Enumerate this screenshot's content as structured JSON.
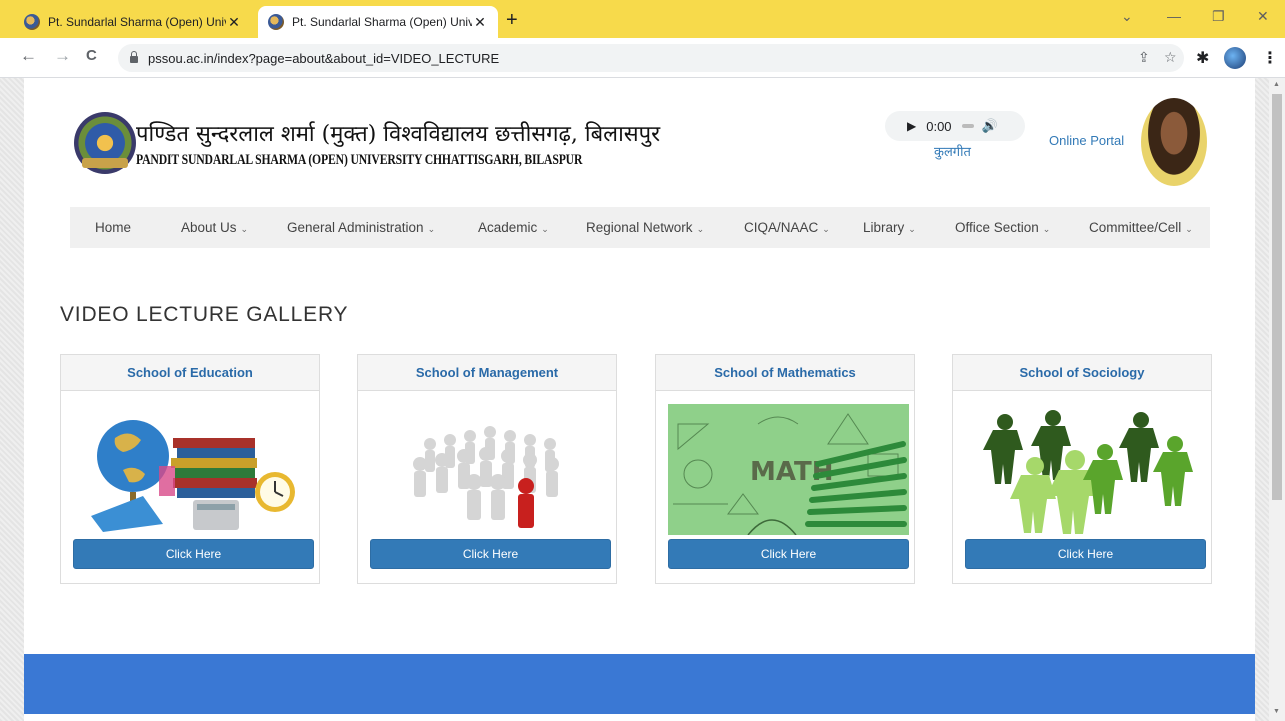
{
  "browser": {
    "tabs": [
      {
        "title": "Pt. Sundarlal Sharma (Open) Univ",
        "close": "✕"
      },
      {
        "title": "Pt. Sundarlal Sharma (Open) Univ",
        "close": "✕"
      }
    ],
    "new_tab": "+",
    "url": "pssou.ac.in/index?page=about&about_id=VIDEO_LECTURE",
    "window_controls": {
      "collapse": "⌄",
      "minimize": "—",
      "restore": "❐",
      "close": "✕"
    },
    "nav": {
      "back": "←",
      "forward": "→",
      "reload": "C"
    },
    "toolbar_icons": {
      "share": "⇪",
      "bookmark": "☆",
      "extensions": "✱",
      "menu": "⋮"
    }
  },
  "header": {
    "university_hindi": "पण्डित सुन्दरलाल शर्मा (मुक्त) विश्वविद्यालय छत्तीसगढ़, बिलासपुर",
    "university_english": "PANDIT SUNDARLAL SHARMA (OPEN) UNIVERSITY CHHATTISGARH, BILASPUR",
    "audio": {
      "play": "▶",
      "time": "0:00",
      "volume": "🔊"
    },
    "kulgeet": "कुलगीत",
    "online_portal": "Online Portal"
  },
  "nav": [
    {
      "label": "Home",
      "dropdown": false
    },
    {
      "label": "About Us",
      "dropdown": true
    },
    {
      "label": "General Administration",
      "dropdown": true
    },
    {
      "label": "Academic",
      "dropdown": true
    },
    {
      "label": "Regional Network",
      "dropdown": true
    },
    {
      "label": "CIQA/NAAC",
      "dropdown": true
    },
    {
      "label": "Library",
      "dropdown": true
    },
    {
      "label": "Office Section",
      "dropdown": true
    },
    {
      "label": "Committee/Cell",
      "dropdown": true
    }
  ],
  "nav_chevron": "⌄",
  "gallery": {
    "title": "VIDEO LECTURE GALLERY",
    "cards": [
      {
        "title": "School of Education",
        "button": "Click Here"
      },
      {
        "title": "School of Management",
        "button": "Click Here"
      },
      {
        "title": "School of Mathematics",
        "button": "Click Here",
        "image_text": "MATH"
      },
      {
        "title": "School of Sociology",
        "button": "Click Here"
      }
    ]
  },
  "colors": {
    "tabbar": "#f7da4b",
    "link": "#337ab7",
    "button": "#337ab7",
    "footer": "#3a78d4"
  }
}
